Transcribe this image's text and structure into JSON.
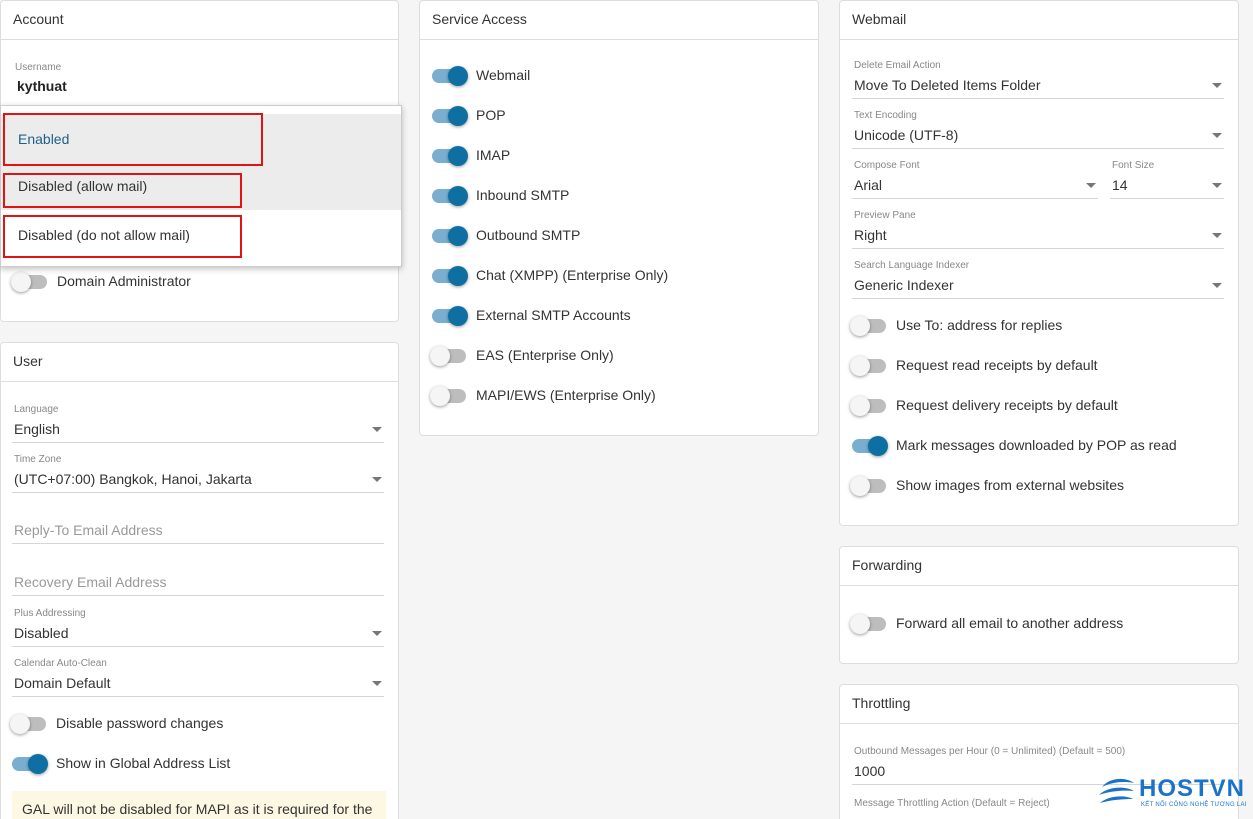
{
  "account": {
    "title": "Account",
    "username_label": "Username",
    "username_value": "kythuat",
    "status_options": [
      "Enabled",
      "Disabled (allow mail)",
      "Disabled (do not allow mail)"
    ],
    "domain_admin_label": "Domain Administrator",
    "domain_admin_on": false
  },
  "user": {
    "title": "User",
    "language_label": "Language",
    "language_value": "English",
    "timezone_label": "Time Zone",
    "timezone_value": "(UTC+07:00) Bangkok, Hanoi, Jakarta",
    "reply_to_placeholder": "Reply-To Email Address",
    "recovery_placeholder": "Recovery Email Address",
    "plus_label": "Plus Addressing",
    "plus_value": "Disabled",
    "calendar_label": "Calendar Auto-Clean",
    "calendar_value": "Domain Default",
    "disable_pw_label": "Disable password changes",
    "show_gal_label": "Show in Global Address List",
    "notice": "GAL will not be disabled for MAPI as it is required for the"
  },
  "service_access": {
    "title": "Service Access",
    "items": [
      {
        "label": "Webmail",
        "on": true
      },
      {
        "label": "POP",
        "on": true
      },
      {
        "label": "IMAP",
        "on": true
      },
      {
        "label": "Inbound SMTP",
        "on": true
      },
      {
        "label": "Outbound SMTP",
        "on": true
      },
      {
        "label": "Chat (XMPP) (Enterprise Only)",
        "on": true
      },
      {
        "label": "External SMTP Accounts",
        "on": true
      },
      {
        "label": "EAS (Enterprise Only)",
        "on": false
      },
      {
        "label": "MAPI/EWS (Enterprise Only)",
        "on": false
      }
    ]
  },
  "webmail": {
    "title": "Webmail",
    "delete_label": "Delete Email Action",
    "delete_value": "Move To Deleted Items Folder",
    "encoding_label": "Text Encoding",
    "encoding_value": "Unicode (UTF-8)",
    "font_label": "Compose Font",
    "font_value": "Arial",
    "size_label": "Font Size",
    "size_value": "14",
    "preview_label": "Preview Pane",
    "preview_value": "Right",
    "indexer_label": "Search Language Indexer",
    "indexer_value": "Generic Indexer",
    "toggles": [
      {
        "label": "Use To: address for replies",
        "on": false
      },
      {
        "label": "Request read receipts by default",
        "on": false
      },
      {
        "label": "Request delivery receipts by default",
        "on": false
      },
      {
        "label": "Mark messages downloaded by POP as read",
        "on": true
      },
      {
        "label": "Show images from external websites",
        "on": false
      }
    ]
  },
  "forwarding": {
    "title": "Forwarding",
    "toggle_label": "Forward all email to another address"
  },
  "throttling": {
    "title": "Throttling",
    "outbound_label": "Outbound Messages per Hour (0 = Unlimited) (Default = 500)",
    "outbound_value": "1000",
    "action_label": "Message Throttling Action (Default = Reject)"
  },
  "logo": {
    "name": "HOSTVN",
    "tagline": "KẾT NỐI CÔNG NGHỆ TƯƠNG LAI"
  },
  "colors": {
    "toggle_on_track": "#7aaed0",
    "toggle_on_knob": "#0e6fa3",
    "highlight_border": "#e01414",
    "selected_text": "#1d5f8a",
    "brand": "#1a73c9"
  }
}
